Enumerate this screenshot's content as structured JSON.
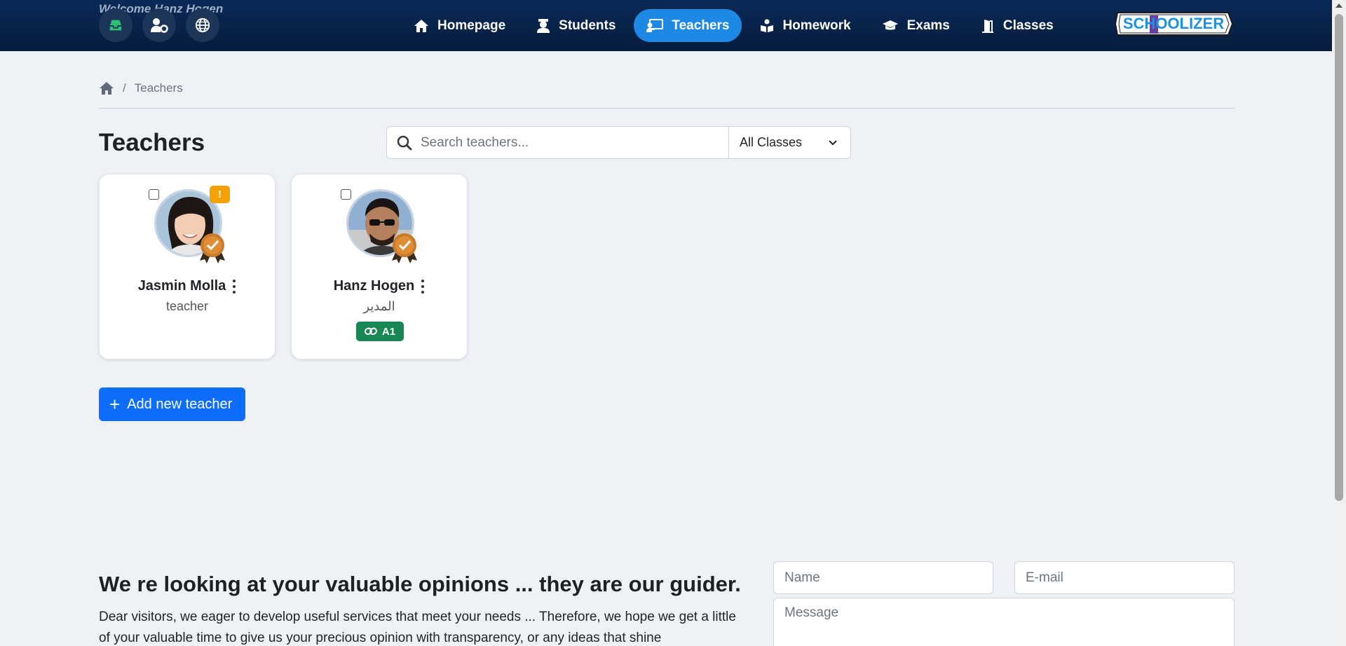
{
  "header": {
    "welcome": "Welcome Hanz Hogen",
    "logo_text": "SCHOOLIZER",
    "nav": [
      {
        "label": "Homepage",
        "icon": "home-icon",
        "active": false
      },
      {
        "label": "Students",
        "icon": "student-icon",
        "active": false
      },
      {
        "label": "Teachers",
        "icon": "teacher-icon",
        "active": true
      },
      {
        "label": "Homework",
        "icon": "book-reader-icon",
        "active": false
      },
      {
        "label": "Exams",
        "icon": "graduation-cap-icon",
        "active": false
      },
      {
        "label": "Classes",
        "icon": "door-icon",
        "active": false
      }
    ]
  },
  "breadcrumb": {
    "sep": "/",
    "current": "Teachers"
  },
  "page": {
    "title": "Teachers",
    "search_placeholder": "Search teachers...",
    "class_filter": "All Classes"
  },
  "teachers": [
    {
      "name": "Jasmin Molla",
      "role": "teacher",
      "warning": "!",
      "class_badge": null
    },
    {
      "name": "Hanz Hogen",
      "role": "المدير",
      "warning": null,
      "class_badge": "A1"
    }
  ],
  "add_button": {
    "label": "Add new teacher"
  },
  "feedback": {
    "title": "We re looking at your valuable opinions ... they are our guider.",
    "text": "Dear visitors, we eager to develop useful services that meet your needs ... Therefore, we hope we get a little of your valuable time to give us your precious opinion with transparency, or any ideas that shine",
    "name_placeholder": "Name",
    "email_placeholder": "E-mail",
    "message_placeholder": "Message"
  },
  "colors": {
    "navbar": "#0a2a57",
    "active_nav": "#1e88e5",
    "primary": "#0d6efd",
    "badge_green": "#198754",
    "warning": "#f5a100"
  }
}
